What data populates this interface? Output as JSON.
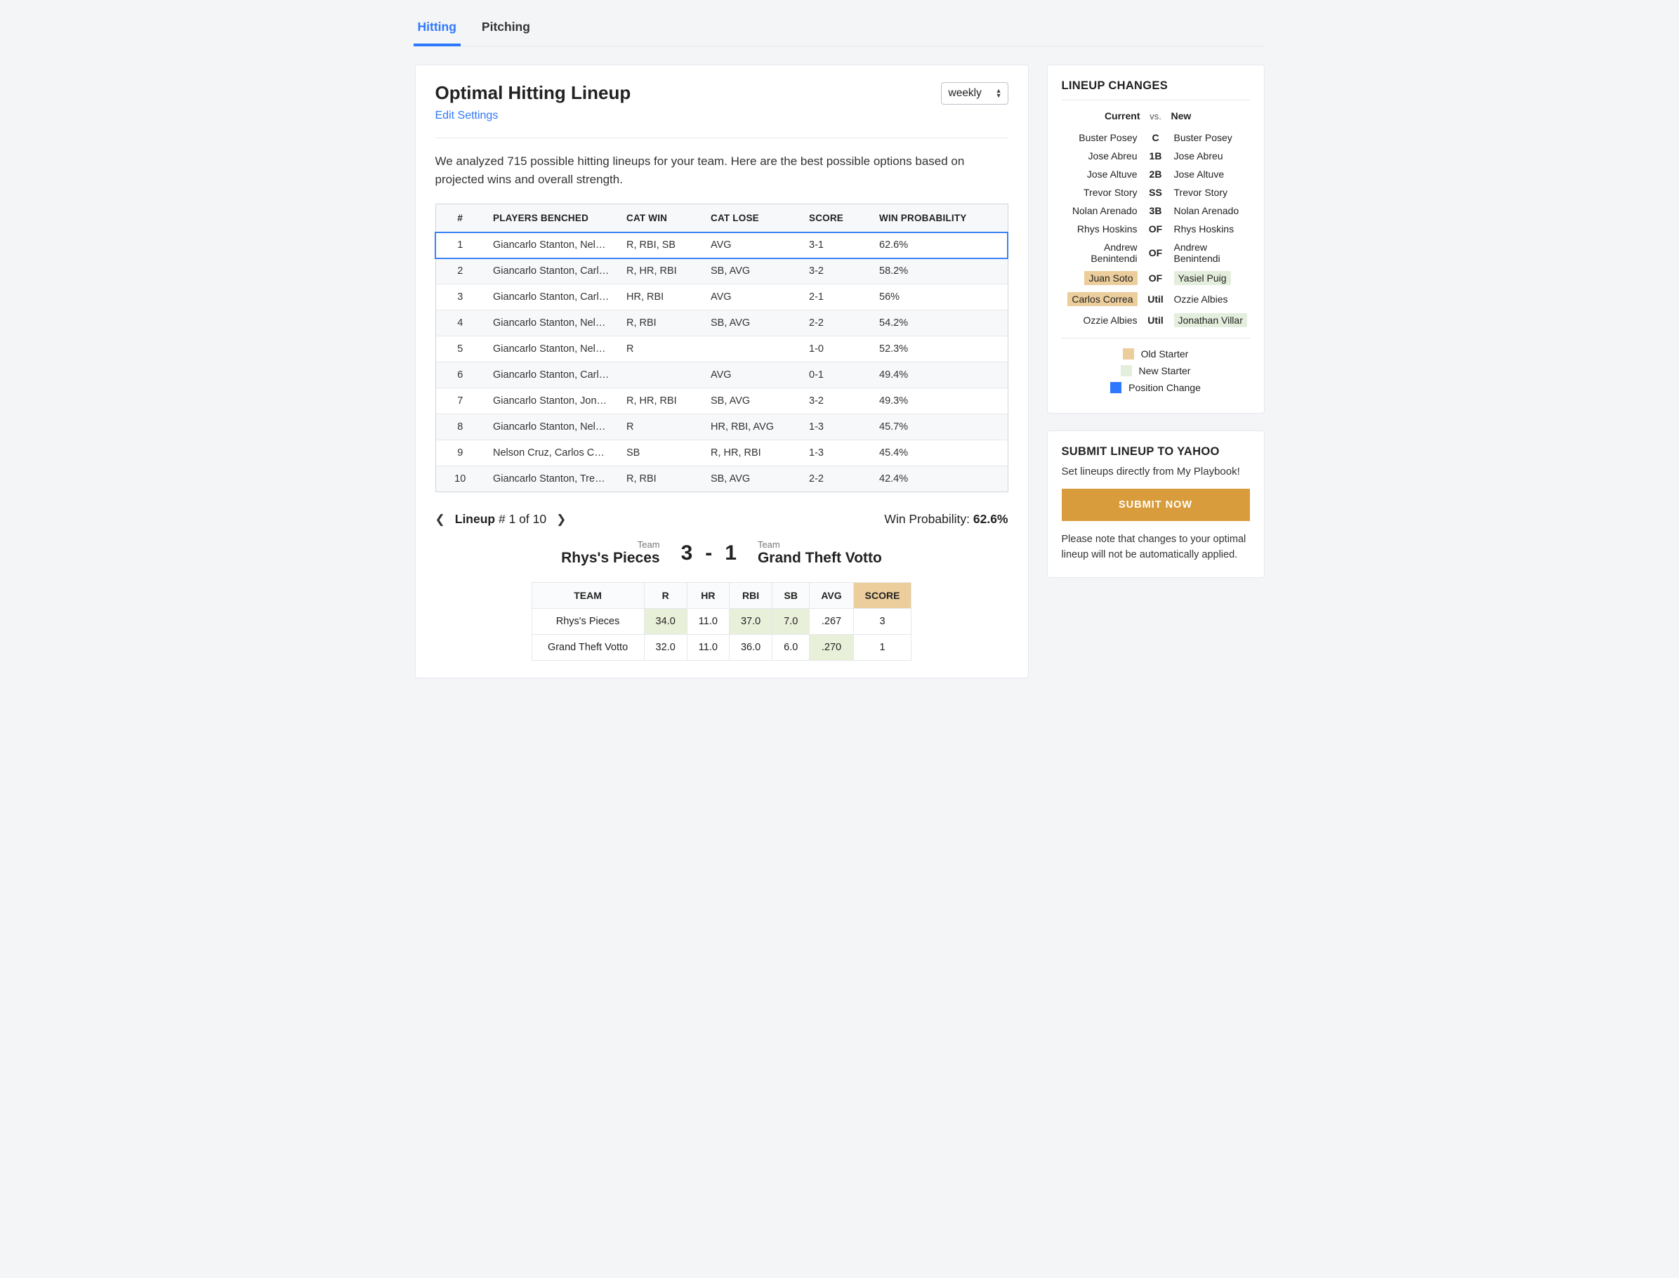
{
  "tabs": {
    "hitting": "Hitting",
    "pitching": "Pitching"
  },
  "header": {
    "title": "Optimal Hitting Lineup",
    "edit": "Edit Settings",
    "period": "weekly"
  },
  "intro": "We analyzed 715 possible hitting lineups for your team. Here are the best possible options based on projected wins and overall strength.",
  "table": {
    "headers": {
      "num": "#",
      "players": "PLAYERS BENCHED",
      "catwin": "CAT WIN",
      "catlose": "CAT LOSE",
      "score": "SCORE",
      "winprob": "WIN PROBABILITY"
    },
    "rows": [
      {
        "num": "1",
        "players": "Giancarlo Stanton, Nelso…",
        "catwin": "R, RBI, SB",
        "catlose": "AVG",
        "score": "3-1",
        "winprob": "62.6%"
      },
      {
        "num": "2",
        "players": "Giancarlo Stanton, Carlos…",
        "catwin": "R, HR, RBI",
        "catlose": "SB, AVG",
        "score": "3-2",
        "winprob": "58.2%"
      },
      {
        "num": "3",
        "players": "Giancarlo Stanton, Carlos…",
        "catwin": "HR, RBI",
        "catlose": "AVG",
        "score": "2-1",
        "winprob": "56%"
      },
      {
        "num": "4",
        "players": "Giancarlo Stanton, Nelso…",
        "catwin": "R, RBI",
        "catlose": "SB, AVG",
        "score": "2-2",
        "winprob": "54.2%"
      },
      {
        "num": "5",
        "players": "Giancarlo Stanton, Nelso…",
        "catwin": "R",
        "catlose": "",
        "score": "1-0",
        "winprob": "52.3%"
      },
      {
        "num": "6",
        "players": "Giancarlo Stanton, Carlos…",
        "catwin": "",
        "catlose": "AVG",
        "score": "0-1",
        "winprob": "49.4%"
      },
      {
        "num": "7",
        "players": "Giancarlo Stanton, Jonath…",
        "catwin": "R, HR, RBI",
        "catlose": "SB, AVG",
        "score": "3-2",
        "winprob": "49.3%"
      },
      {
        "num": "8",
        "players": "Giancarlo Stanton, Nelso…",
        "catwin": "R",
        "catlose": "HR, RBI, AVG",
        "score": "1-3",
        "winprob": "45.7%"
      },
      {
        "num": "9",
        "players": "Nelson Cruz, Carlos Corre…",
        "catwin": "SB",
        "catlose": "R, HR, RBI",
        "score": "1-3",
        "winprob": "45.4%"
      },
      {
        "num": "10",
        "players": "Giancarlo Stanton, Trevor…",
        "catwin": "R, RBI",
        "catlose": "SB, AVG",
        "score": "2-2",
        "winprob": "42.4%"
      }
    ]
  },
  "lineup_nav": {
    "label_prefix": "Lineup",
    "position": "# 1 of 10",
    "winprob_label": "Win Probability:",
    "winprob_value": "62.6%"
  },
  "matchup": {
    "team_label": "Team",
    "team_a": "Rhys's Pieces",
    "score_a": "3",
    "dash": "-",
    "score_b": "1",
    "team_b": "Grand Theft Votto"
  },
  "score_table": {
    "headers": {
      "team": "TEAM",
      "r": "R",
      "hr": "HR",
      "rbi": "RBI",
      "sb": "SB",
      "avg": "AVG",
      "score": "SCORE"
    },
    "rows": [
      {
        "team": "Rhys's Pieces",
        "r": "34.0",
        "hr": "11.0",
        "rbi": "37.0",
        "sb": "7.0",
        "avg": ".267",
        "score": "3",
        "wins": [
          "r",
          "rbi",
          "sb"
        ],
        "lose": []
      },
      {
        "team": "Grand Theft Votto",
        "r": "32.0",
        "hr": "11.0",
        "rbi": "36.0",
        "sb": "6.0",
        "avg": ".270",
        "score": "1",
        "wins": [
          "avg"
        ],
        "lose": []
      }
    ]
  },
  "changes": {
    "title": "LINEUP CHANGES",
    "hdr": {
      "current": "Current",
      "vs": "vs.",
      "new": "New"
    },
    "rows": [
      {
        "pos": "C",
        "current": "Buster Posey",
        "new": "Buster Posey",
        "old_hl": false,
        "new_hl": false
      },
      {
        "pos": "1B",
        "current": "Jose Abreu",
        "new": "Jose Abreu",
        "old_hl": false,
        "new_hl": false
      },
      {
        "pos": "2B",
        "current": "Jose Altuve",
        "new": "Jose Altuve",
        "old_hl": false,
        "new_hl": false
      },
      {
        "pos": "SS",
        "current": "Trevor Story",
        "new": "Trevor Story",
        "old_hl": false,
        "new_hl": false
      },
      {
        "pos": "3B",
        "current": "Nolan Arenado",
        "new": "Nolan Arenado",
        "old_hl": false,
        "new_hl": false
      },
      {
        "pos": "OF",
        "current": "Rhys Hoskins",
        "new": "Rhys Hoskins",
        "old_hl": false,
        "new_hl": false
      },
      {
        "pos": "OF",
        "current": "Andrew Benintendi",
        "new": "Andrew Benintendi",
        "old_hl": false,
        "new_hl": false
      },
      {
        "pos": "OF",
        "current": "Juan Soto",
        "new": "Yasiel Puig",
        "old_hl": true,
        "new_hl": true
      },
      {
        "pos": "Util",
        "current": "Carlos Correa",
        "new": "Ozzie Albies",
        "old_hl": true,
        "new_hl": false
      },
      {
        "pos": "Util",
        "current": "Ozzie Albies",
        "new": "Jonathan Villar",
        "old_hl": false,
        "new_hl": true
      }
    ],
    "legend": {
      "old": "Old Starter",
      "new": "New Starter",
      "pos": "Position Change"
    }
  },
  "submit": {
    "title": "SUBMIT LINEUP TO YAHOO",
    "note": "Set lineups directly from My Playbook!",
    "button": "SUBMIT NOW",
    "foot": "Please note that changes to your optimal lineup will not be automatically applied."
  }
}
